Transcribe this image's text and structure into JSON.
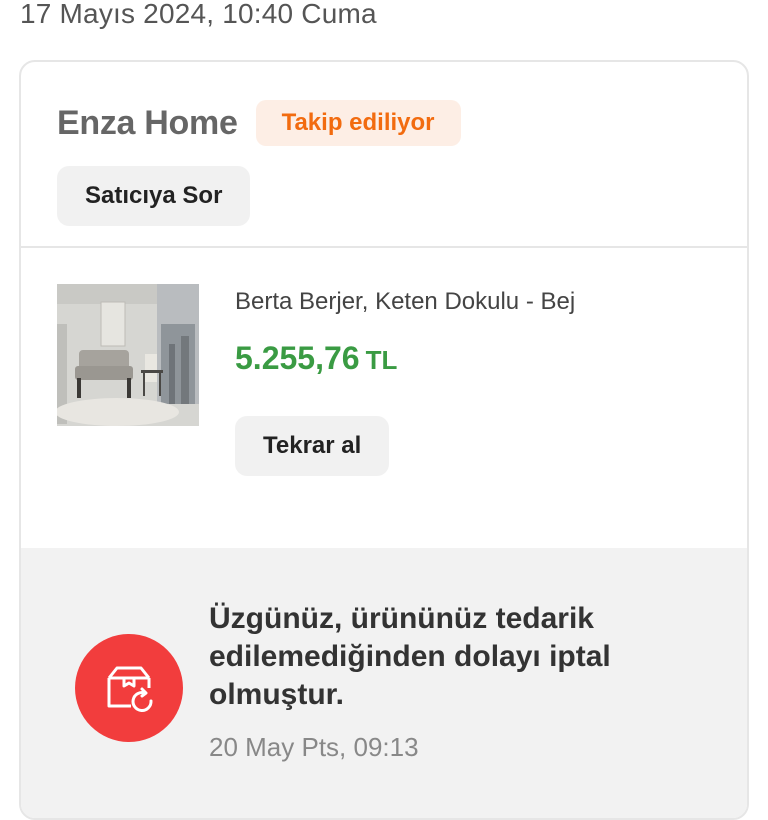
{
  "order": {
    "date_header": "17 Mayıs 2024, 10:40 Cuma"
  },
  "seller": {
    "name": "Enza Home",
    "follow_status": "Takip ediliyor",
    "ask_seller_label": "Satıcıya Sor"
  },
  "product": {
    "title": "Berta Berjer, Keten Dokulu - Bej",
    "price_amount": "5.255,76",
    "price_currency": "TL",
    "rebuy_label": "Tekrar al",
    "image_icon": "armchair-product-photo"
  },
  "status": {
    "icon": "box-cancel-icon",
    "message": "Üzgünüz, ürününüz tedarik edilemediğinden dolayı iptal olmuştur.",
    "time": "20 May Pts, 09:13",
    "color": "#f23d3d"
  },
  "colors": {
    "accent_orange": "#f26b0f",
    "price_green": "#3a9b43"
  }
}
